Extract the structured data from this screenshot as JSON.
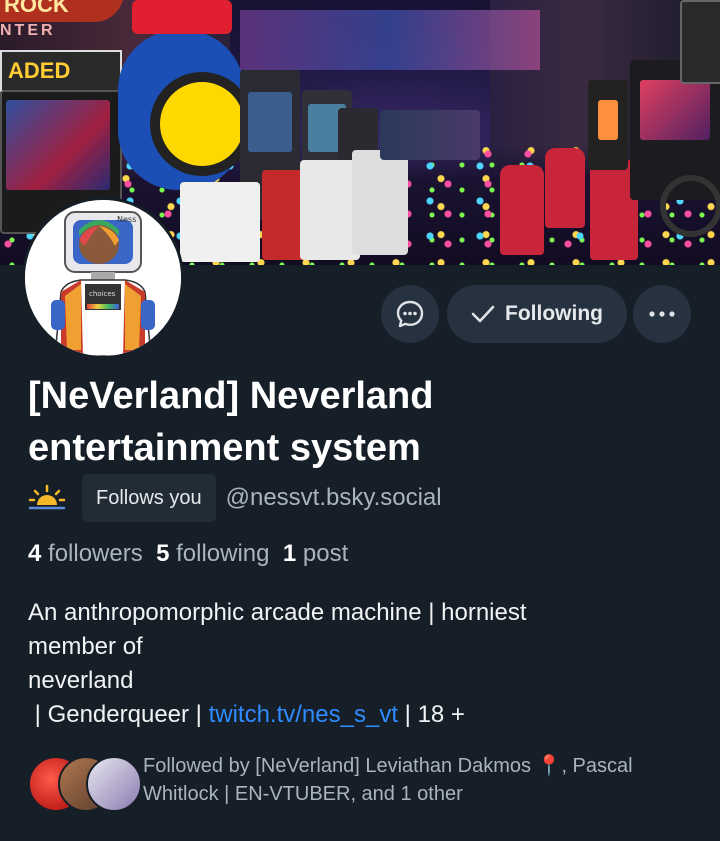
{
  "profile": {
    "display_name": "[NeVerland] Neverland entertainment system",
    "handle": "@nessvt.bsky.social",
    "follows_you_label": "Follows you",
    "status_emoji_icon": "sunrise-icon",
    "avatar_name_tag": "Ness",
    "avatar_shirt_text": "choices"
  },
  "banner": {
    "sign_top": "ROCK",
    "sign_enter": "NTER",
    "sign_loaded": "ADED"
  },
  "actions": {
    "message_icon": "chat-bubble-icon",
    "following_label": "Following",
    "following_icon": "checkmark-icon",
    "more_icon": "ellipsis-icon"
  },
  "stats": {
    "followers_count": "4",
    "followers_label": "followers",
    "following_count": "5",
    "following_label": "following",
    "posts_count": "1",
    "posts_label": "post"
  },
  "bio": {
    "line1": "An anthropomorphic arcade machine | horniest",
    "line2": "member of",
    "line3": "neverland",
    "line4_prefix": " | Genderqueer | ",
    "link": "twitch.tv/nes_s_vt",
    "line4_suffix": " | 18 +"
  },
  "followed_by": {
    "text": "Followed by [NeVerland] Leviathan Dakmos 📍, Pascal Whitlock | EN-VTUBER, and 1 other"
  },
  "colors": {
    "background": "#161e27",
    "button_bg": "#273240",
    "link": "#2f8cff",
    "muted_text": "#aab4c0"
  }
}
